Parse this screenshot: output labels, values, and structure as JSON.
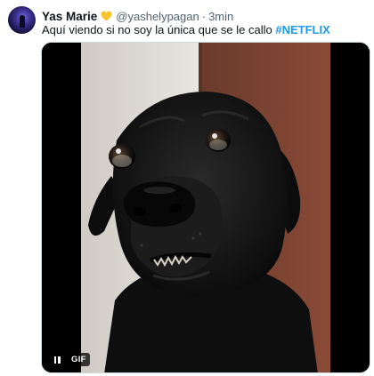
{
  "tweet": {
    "author_name": "Yas Marie",
    "handle": "@yashelypagan",
    "separator": "·",
    "time": "3min",
    "text_prefix": "Aquí viendo si no soy la única que se le callo ",
    "hashtag": "#NETFLIX",
    "badge_icon": "yellow-heart-icon",
    "media": {
      "type": "gif",
      "subject": "black-dog-gif",
      "badge_label": "GIF",
      "control_icon": "pause-icon"
    }
  },
  "colors": {
    "text_primary": "#0f1419",
    "text_secondary": "#536471",
    "hashtag": "#1d9bf0",
    "heart": "#f7c431",
    "media_bg": "#000000"
  }
}
